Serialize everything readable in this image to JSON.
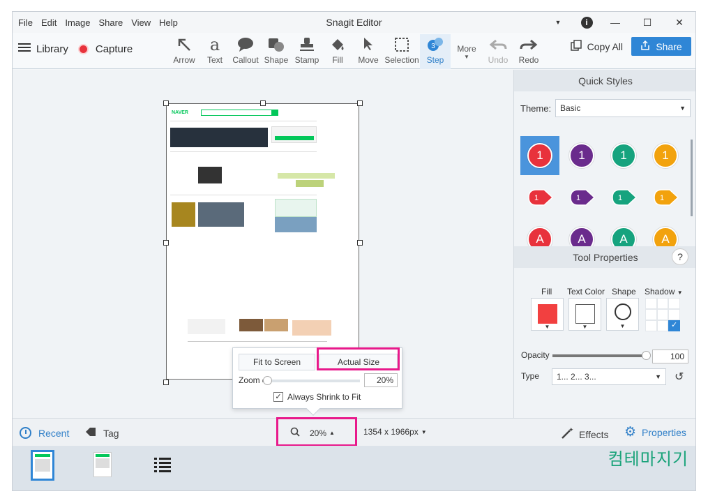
{
  "menu": [
    "File",
    "Edit",
    "Image",
    "Share",
    "View",
    "Help"
  ],
  "app_title": "Snagit Editor",
  "toolbar": {
    "library": "Library",
    "capture": "Capture",
    "tools": [
      {
        "label": "Arrow",
        "icon": "arrow-icon"
      },
      {
        "label": "Text",
        "icon": "text-icon"
      },
      {
        "label": "Callout",
        "icon": "callout-icon"
      },
      {
        "label": "Shape",
        "icon": "shape-icon"
      },
      {
        "label": "Stamp",
        "icon": "stamp-icon"
      },
      {
        "label": "Fill",
        "icon": "fill-icon"
      },
      {
        "label": "Move",
        "icon": "move-icon"
      },
      {
        "label": "Selection",
        "icon": "selection-icon"
      },
      {
        "label": "Step",
        "icon": "step-icon",
        "selected": true
      }
    ],
    "more": "More",
    "undo": "Undo",
    "redo": "Redo",
    "copy_all": "Copy All",
    "share": "Share"
  },
  "zoom_popup": {
    "fit_to_screen": "Fit to Screen",
    "actual_size": "Actual Size",
    "zoom_label": "Zoom",
    "zoom_value": "20%",
    "zoom_slider_level": 0.05,
    "always_shrink": "Always Shrink to Fit",
    "always_shrink_checked": true
  },
  "statusbar": {
    "recent": "Recent",
    "tag": "Tag",
    "zoom": "20%",
    "dimensions": "1354 x 1966px",
    "effects": "Effects",
    "properties": "Properties"
  },
  "quick_styles": {
    "header": "Quick Styles",
    "theme_label": "Theme:",
    "theme_value": "Basic",
    "rows": [
      {
        "kind": "circle",
        "text": "1",
        "colors": [
          "#e8323c",
          "#6a2b8c",
          "#16a37e",
          "#f2a20d"
        ]
      },
      {
        "kind": "pointer",
        "text": "1",
        "colors": [
          "#e8323c",
          "#6a2b8c",
          "#16a37e",
          "#f2a20d"
        ]
      },
      {
        "kind": "circle",
        "text": "A",
        "colors": [
          "#e8323c",
          "#6a2b8c",
          "#16a37e",
          "#f2a20d"
        ]
      }
    ]
  },
  "tool_properties": {
    "header": "Tool Properties",
    "help": "?",
    "fill_label": "Fill",
    "text_color_label": "Text Color",
    "shape_label": "Shape",
    "shadow_label": "Shadow",
    "fill_color": "#f24040",
    "opacity_label": "Opacity",
    "opacity_value": "100",
    "type_label": "Type",
    "type_value": "1... 2... 3..."
  },
  "page_preview": {
    "logo": "NAVER"
  },
  "watermark": "컴테마지기",
  "colors": {
    "accent": "#2f86d6",
    "highlight_box": "#e8198b"
  }
}
